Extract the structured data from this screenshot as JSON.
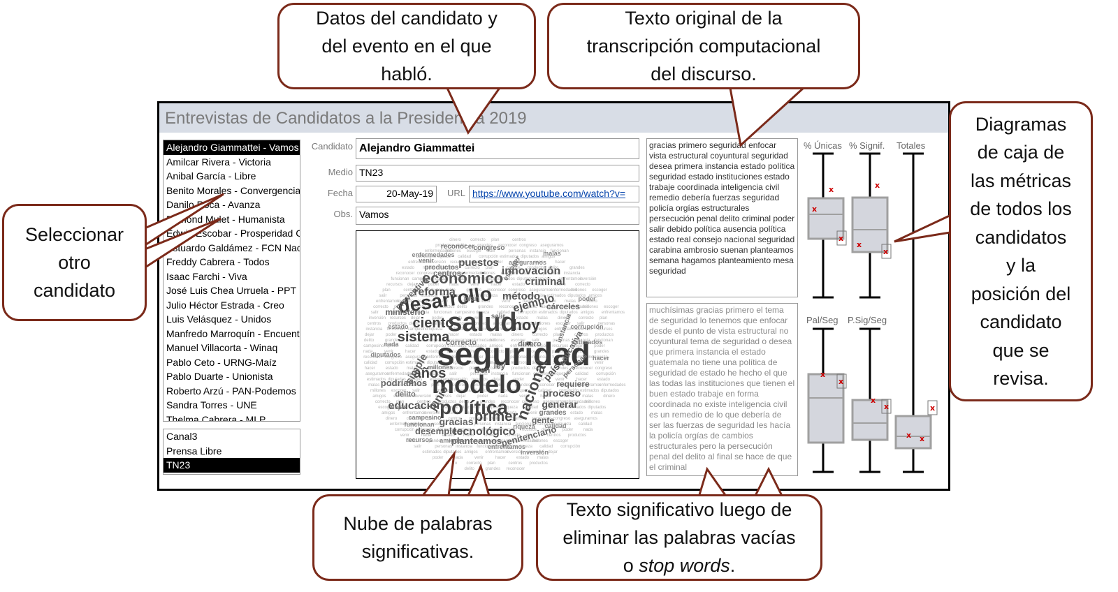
{
  "app": {
    "title": "Entrevistas de Candidatos a la Presidencia 2019"
  },
  "candidates": [
    {
      "label": "Alejandro Giammattei - Vamos",
      "selected": true
    },
    {
      "label": "Amilcar Rivera - Victoria",
      "selected": false
    },
    {
      "label": "Anibal García - Libre",
      "selected": false
    },
    {
      "label": "Benito Morales - Convergencia",
      "selected": false
    },
    {
      "label": "Danilo Roca - Avanza",
      "selected": false
    },
    {
      "label": "Edmond Mulet - Humanista",
      "selected": false
    },
    {
      "label": "Edwin Escobar - Prosperidad Ciudadana",
      "selected": false
    },
    {
      "label": "Estuardo Galdámez - FCN Nación",
      "selected": false
    },
    {
      "label": "Freddy Cabrera - Todos",
      "selected": false
    },
    {
      "label": "Isaac Farchi - Viva",
      "selected": false
    },
    {
      "label": "José Luis Chea Urruela - PPT",
      "selected": false
    },
    {
      "label": "Julio Héctor Estrada - Creo",
      "selected": false
    },
    {
      "label": "Luis Velásquez - Unidos",
      "selected": false
    },
    {
      "label": "Manfredo Marroquín - Encuentro",
      "selected": false
    },
    {
      "label": "Manuel Villacorta - Winaq",
      "selected": false
    },
    {
      "label": "Pablo Ceto - URNG-Maíz",
      "selected": false
    },
    {
      "label": "Pablo Duarte - Unionista",
      "selected": false
    },
    {
      "label": "Roberto Arzú - PAN-Podemos",
      "selected": false
    },
    {
      "label": "Sandra Torres - UNE",
      "selected": false
    },
    {
      "label": "Thelma Cabrera - MLP",
      "selected": false
    }
  ],
  "media": [
    {
      "label": "Canal3",
      "selected": false
    },
    {
      "label": "Prensa Libre",
      "selected": false
    },
    {
      "label": "TN23",
      "selected": true
    }
  ],
  "form": {
    "candidato_label": "Candidato",
    "candidato_value": "Alejandro Giammattei",
    "medio_label": "Medio",
    "medio_value": "TN23",
    "fecha_label": "Fecha",
    "fecha_value": "20-May-19",
    "url_label": "URL",
    "url_value": "https://www.youtube.com/watch?v=",
    "obs_label": "Obs.",
    "obs_value": "Vamos"
  },
  "original_text": "gracias primero seguridad enfocar vista estructural coyuntural seguridad desea primera instancia estado política seguridad estado instituciones estado trabaje coordinada inteligencia civil remedio debería fuerzas seguridad policía orgías estructurales persecución penal delito criminal poder salir debido política ausencia política estado real consejo nacional seguridad carabina ambrosio suenan planteamos semana hagamos planteamiento mesa seguridad",
  "significant_text": "muchísimas gracias primero el tema de seguridad lo tenemos que enfocar desde el punto de vista estructural no coyuntural tema de seguridad o desea que primera instancia el estado guatemala no tiene una política de seguridad de estado he hecho el que las todas las instituciones que tienen el buen estado trabaje en forma coordinada no existe inteligencia civil es un remedio de lo que debería de ser las fuerzas de seguridad les hacía la policía orgías de cambios estructurales pero la persecución penal del delito al final se hace de que el criminal",
  "word_cloud": {
    "words": [
      {
        "text": "seguridad",
        "size": 46,
        "color": "#3a3a3a"
      },
      {
        "text": "salud",
        "size": 38,
        "color": "#444444"
      },
      {
        "text": "modelo",
        "size": 36,
        "color": "#3d3d3d"
      },
      {
        "text": "política",
        "size": 28,
        "color": "#444444"
      },
      {
        "text": "desarrollo",
        "size": 28,
        "color": "#3a3a3a"
      },
      {
        "text": "económico",
        "size": 22,
        "color": "#555555"
      },
      {
        "text": "nacional",
        "size": 22,
        "color": "#4a4a4a"
      },
      {
        "text": "sistema",
        "size": 20,
        "color": "#444444"
      },
      {
        "text": "ciento",
        "size": 20,
        "color": "#444444"
      },
      {
        "text": "hoy",
        "size": 22,
        "color": "#3e3e3e"
      },
      {
        "text": "años",
        "size": 20,
        "color": "#444444"
      },
      {
        "text": "primer",
        "size": 20,
        "color": "#4a4a4a"
      },
      {
        "text": "educación",
        "size": 16,
        "color": "#555555"
      },
      {
        "text": "innovación",
        "size": 16,
        "color": "#555555"
      },
      {
        "text": "reforma",
        "size": 16,
        "color": "#555555"
      },
      {
        "text": "tecnológico",
        "size": 16,
        "color": "#555555"
      },
      {
        "text": "ejemplo",
        "size": 16,
        "color": "#555555"
      },
      {
        "text": "puestos",
        "size": 15,
        "color": "#555555"
      },
      {
        "text": "criminal",
        "size": 15,
        "color": "#555555"
      },
      {
        "text": "método",
        "size": 15,
        "color": "#555555"
      },
      {
        "text": "junio",
        "size": 16,
        "color": "#555555"
      },
      {
        "text": "simple",
        "size": 15,
        "color": "#666666"
      },
      {
        "text": "gracias",
        "size": 14,
        "color": "#666666"
      },
      {
        "text": "proceso",
        "size": 14,
        "color": "#555555"
      },
      {
        "text": "generar",
        "size": 14,
        "color": "#555555"
      },
      {
        "text": "país",
        "size": 14,
        "color": "#555555"
      },
      {
        "text": "planteamos",
        "size": 13,
        "color": "#666666"
      },
      {
        "text": "penitenciario",
        "size": 13,
        "color": "#666666"
      },
      {
        "text": "desempleo",
        "size": 13,
        "color": "#666666"
      },
      {
        "text": "podríamos",
        "size": 13,
        "color": "#666666"
      },
      {
        "text": "ministerio",
        "size": 12,
        "color": "#666666"
      },
      {
        "text": "educativa",
        "size": 12,
        "color": "#666666"
      },
      {
        "text": "preventiva",
        "size": 12,
        "color": "#666666"
      },
      {
        "text": "cárceles",
        "size": 12,
        "color": "#666666"
      },
      {
        "text": "requiere",
        "size": 12,
        "color": "#666666"
      },
      {
        "text": "gente",
        "size": 12,
        "color": "#666666"
      },
      {
        "text": "dinero",
        "size": 11,
        "color": "#777777"
      },
      {
        "text": "correcto",
        "size": 11,
        "color": "#777777"
      },
      {
        "text": "tren",
        "size": 12,
        "color": "#666666"
      },
      {
        "text": "ley",
        "size": 12,
        "color": "#666666"
      },
      {
        "text": "plan",
        "size": 11,
        "color": "#777777"
      },
      {
        "text": "centros",
        "size": 11,
        "color": "#777777"
      },
      {
        "text": "productos",
        "size": 10,
        "color": "#777777"
      },
      {
        "text": "delito",
        "size": 11,
        "color": "#777777"
      },
      {
        "text": "grandes",
        "size": 10,
        "color": "#777777"
      },
      {
        "text": "reconocer",
        "size": 10,
        "color": "#777777"
      },
      {
        "text": "congreso",
        "size": 10,
        "color": "#777777"
      },
      {
        "text": "asegurarnos",
        "size": 9,
        "color": "#888888"
      },
      {
        "text": "enfermedades",
        "size": 9,
        "color": "#888888"
      },
      {
        "text": "millones",
        "size": 9,
        "color": "#888888"
      },
      {
        "text": "escoger",
        "size": 10,
        "color": "#777777"
      },
      {
        "text": "salir",
        "size": 10,
        "color": "#777777"
      },
      {
        "text": "personas",
        "size": 10,
        "color": "#777777"
      },
      {
        "text": "instancia",
        "size": 10,
        "color": "#777777"
      },
      {
        "text": "funcionan",
        "size": 9,
        "color": "#888888"
      },
      {
        "text": "campesino",
        "size": 9,
        "color": "#888888"
      },
      {
        "text": "riqueza",
        "size": 9,
        "color": "#888888"
      },
      {
        "text": "calidad",
        "size": 9,
        "color": "#888888"
      },
      {
        "text": "corrupción",
        "size": 9,
        "color": "#888888"
      },
      {
        "text": "estimados",
        "size": 9,
        "color": "#888888"
      },
      {
        "text": "diputados",
        "size": 9,
        "color": "#888888"
      },
      {
        "text": "amigos",
        "size": 9,
        "color": "#888888"
      },
      {
        "text": "enfrentamos",
        "size": 9,
        "color": "#888888"
      },
      {
        "text": "inversión",
        "size": 9,
        "color": "#888888"
      },
      {
        "text": "recursos",
        "size": 9,
        "color": "#888888"
      },
      {
        "text": "dejar",
        "size": 9,
        "color": "#888888"
      },
      {
        "text": "poder",
        "size": 9,
        "color": "#888888"
      },
      {
        "text": "nada",
        "size": 9,
        "color": "#888888"
      },
      {
        "text": "venir",
        "size": 9,
        "color": "#888888"
      },
      {
        "text": "hacer",
        "size": 9,
        "color": "#888888"
      },
      {
        "text": "estado",
        "size": 9,
        "color": "#888888"
      },
      {
        "text": "malas",
        "size": 9,
        "color": "#888888"
      }
    ]
  },
  "metrics": {
    "top_labels": [
      "% Únicas",
      "% Signif.",
      "Totales"
    ],
    "bottom_labels": [
      "Pal/Seg",
      "P.Sig/Seg"
    ],
    "box_color": "#d4d6dd",
    "box_edge": "#a0a0a0",
    "marker_color": "#cc0000",
    "marker_glyph": "x"
  },
  "callouts": {
    "datos": [
      "Datos del candidato y",
      "del evento en el que",
      "habló."
    ],
    "texto_original": [
      "Texto original de la",
      "transcripción computacional",
      "del discurso."
    ],
    "diagramas": [
      "Diagramas",
      "de caja de",
      "las métricas",
      "de todos los",
      "candidatos",
      "y la",
      "posición del",
      "candidato",
      "que se",
      "revisa."
    ],
    "seleccionar": [
      "Seleccionar",
      "otro",
      "candidato"
    ],
    "nube": [
      "Nube de palabras",
      "significativas."
    ],
    "texto_sig_line1": "Texto significativo luego de",
    "texto_sig_line2": "eliminar las palabras vacías",
    "texto_sig_line3_prefix": "o ",
    "texto_sig_line3_em": "stop words",
    "texto_sig_line3_suffix": "."
  }
}
